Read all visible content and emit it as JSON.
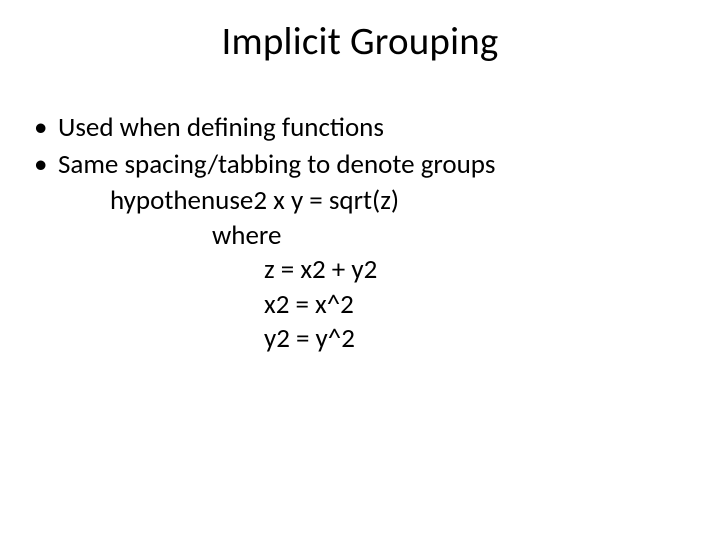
{
  "title": "Implicit Grouping",
  "bullets": [
    "Used when defining functions",
    "Same spacing/tabbing to denote groups"
  ],
  "code": {
    "l1": "hypothenuse2 x y = sqrt(z)",
    "l2": "where",
    "l3": "z = x2 + y2",
    "l4": "x2 = x^2",
    "l5": "y2 = y^2"
  }
}
